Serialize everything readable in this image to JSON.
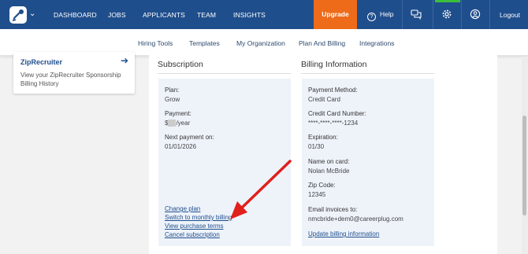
{
  "topnav": {
    "items": [
      "DASHBOARD",
      "JOBS",
      "APPLICANTS",
      "TEAM",
      "INSIGHTS"
    ],
    "upgrade": "Upgrade",
    "help": "Help",
    "logout": "Logout",
    "icons": [
      "logo-icon",
      "chat-icon",
      "gear-icon",
      "user-icon"
    ]
  },
  "subnav": {
    "items": [
      "Hiring Tools",
      "Templates",
      "My Organization",
      "Plan And Billing",
      "Integrations"
    ],
    "active": "Plan And Billing"
  },
  "sidebar_card": {
    "title": "ZipRecruiter",
    "description": "View your ZipRecruiter Sponsorship Billing History"
  },
  "subscription": {
    "heading": "Subscription",
    "plan_label": "Plan:",
    "plan_value": "Grow",
    "payment_label": "Payment:",
    "payment_prefix": "$",
    "payment_suffix": "/year",
    "next_label": "Next payment on:",
    "next_value": "01/01/2026",
    "links": [
      "Change plan",
      "Switch to monthly billing",
      "View purchase terms",
      "Cancel subscription"
    ]
  },
  "billing": {
    "heading": "Billing Information",
    "method_label": "Payment Method:",
    "method_value": "Credit Card",
    "card_label": "Credit Card Number:",
    "card_value": "****-****-****-1234",
    "exp_label": "Expiration:",
    "exp_value": "01/30",
    "name_label": "Name on card:",
    "name_value": "Nolan McBride",
    "zip_label": "Zip Code:",
    "zip_value": "12345",
    "email_label": "Email invoices to:",
    "email_value": "nmcbride+dem0@careerplug.com",
    "update_link": "Update billing information"
  },
  "colors": {
    "nav_bg": "#1f4e8c",
    "upgrade_bg": "#ee6b1a",
    "box_bg": "#eef3fa",
    "arrow": "#e0201b",
    "active_indicator": "#3bbf3b"
  }
}
